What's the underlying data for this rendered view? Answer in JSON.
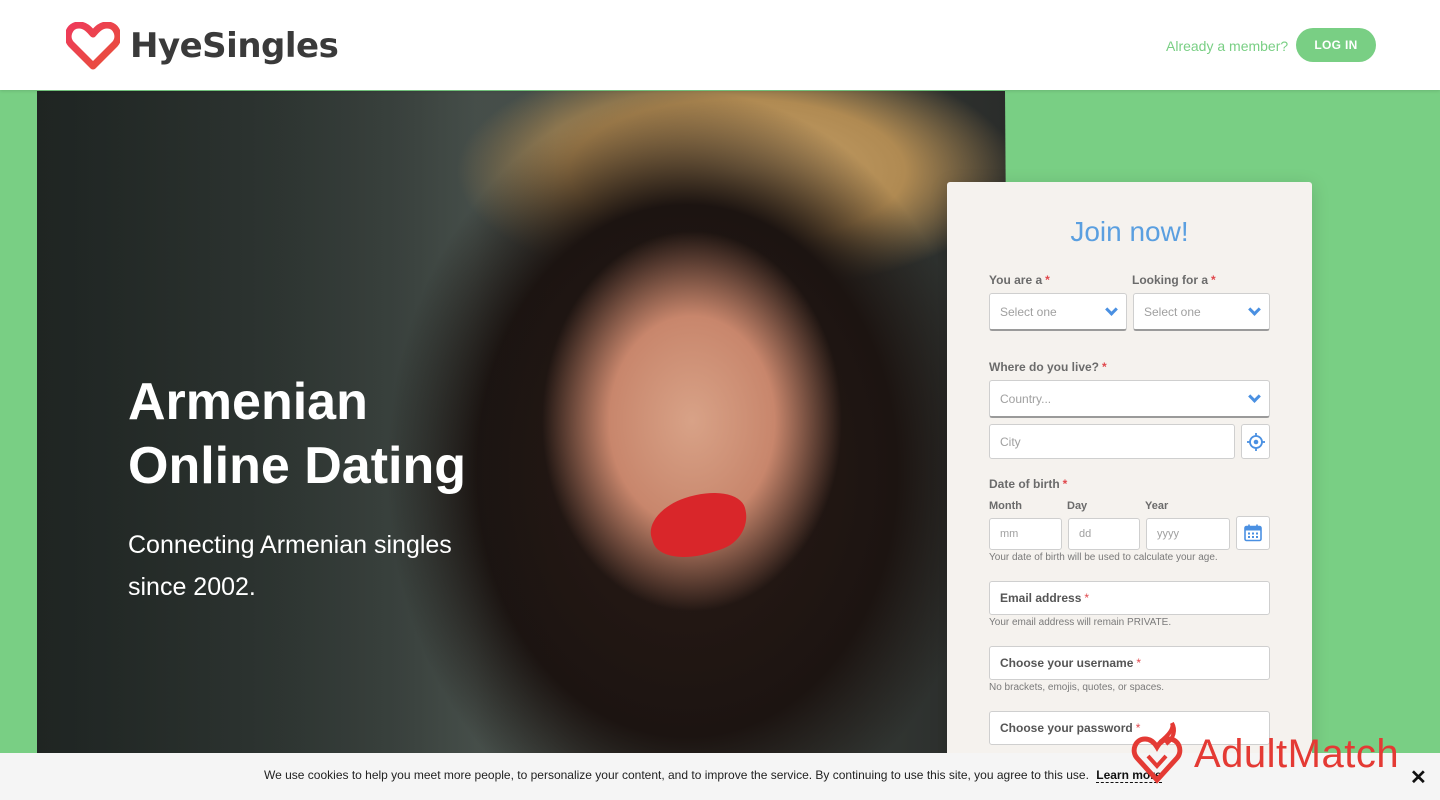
{
  "header": {
    "brand": "HyeSingles",
    "member_prompt": "Already a member?",
    "login_label": "LOG IN"
  },
  "hero": {
    "title_line1": "Armenian",
    "title_line2": "Online Dating",
    "subtitle_line1": "Connecting Armenian singles",
    "subtitle_line2": "since 2002."
  },
  "form": {
    "title": "Join now!",
    "you_are": {
      "label": "You are a",
      "placeholder": "Select one"
    },
    "looking_for": {
      "label": "Looking for a",
      "placeholder": "Select one"
    },
    "location": {
      "label": "Where do you live?",
      "country_placeholder": "Country...",
      "city_placeholder": "City"
    },
    "dob": {
      "label": "Date of birth",
      "month_label": "Month",
      "month_placeholder": "mm",
      "day_label": "Day",
      "day_placeholder": "dd",
      "year_label": "Year",
      "year_placeholder": "yyyy",
      "hint": "Your date of birth will be used to calculate your age."
    },
    "email": {
      "placeholder": "Email address",
      "hint": "Your email address will remain PRIVATE."
    },
    "username": {
      "placeholder": "Choose your username",
      "hint": "No brackets, emojis, quotes, or spaces."
    },
    "password": {
      "placeholder": "Choose your password"
    },
    "required_mark": "*"
  },
  "cookie": {
    "text": "We use cookies to help you meet more people, to personalize your content, and to improve the service. By continuing to use this site, you agree to this use.",
    "link": "Learn more",
    "close": "✕"
  },
  "watermark": {
    "text": "AdultMatch"
  },
  "colors": {
    "brand_green": "#79cf84",
    "accent_blue": "#5a9fe0",
    "required_red": "#e0474c",
    "logo_red": "#e43a34"
  },
  "icons": {
    "location": "crosshair-icon",
    "calendar": "calendar-icon",
    "dropdown": "chevron-down-icon"
  }
}
